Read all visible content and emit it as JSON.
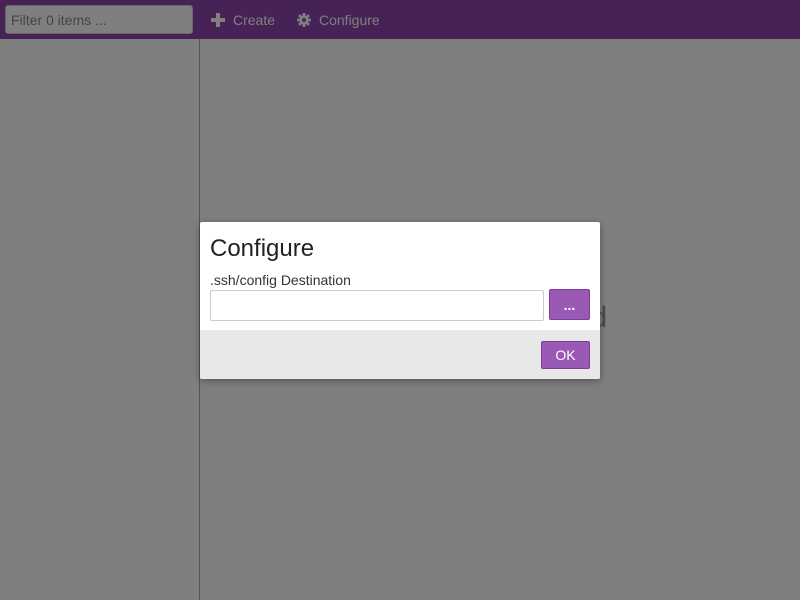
{
  "toolbar": {
    "filter_placeholder": "Filter 0 items ...",
    "create_label": "Create",
    "create_icon": "plus-icon",
    "configure_label": "Configure",
    "configure_icon": "gear-icon",
    "background_color": "#8e44ad"
  },
  "main": {
    "empty_message_visible_fragment": "ed"
  },
  "dialog": {
    "title": "Configure",
    "field_label": ".ssh/config Destination",
    "field_value": "",
    "browse_label": "...",
    "ok_label": "OK",
    "accent_color": "#9b59b6"
  }
}
